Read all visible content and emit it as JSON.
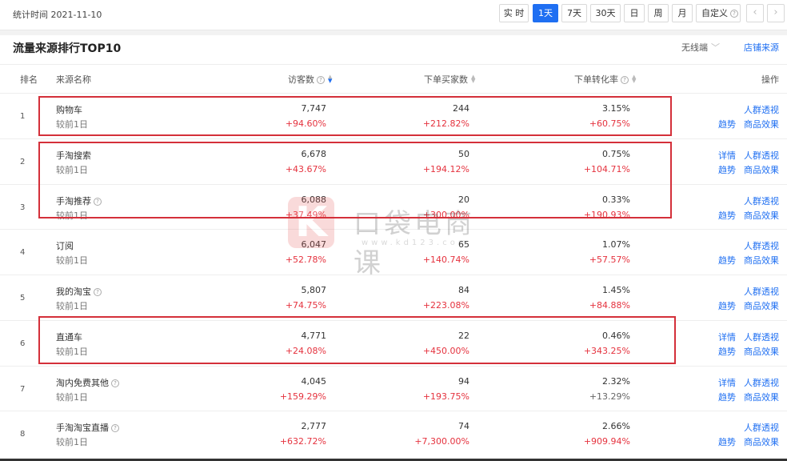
{
  "topbar": {
    "stat_time": "统计时间 2021-11-10",
    "buttons": [
      "实 时",
      "1天",
      "7天",
      "30天",
      "日",
      "周",
      "月",
      "自定义"
    ],
    "prev": "‹",
    "next": "›"
  },
  "section": {
    "title": "流量来源排行TOP10",
    "device": "无线端",
    "shop_source": "店铺来源"
  },
  "columns": {
    "rank": "排名",
    "source": "来源名称",
    "visitors": "访客数",
    "buyers": "下单买家数",
    "conversion": "下单转化率",
    "action": "操作"
  },
  "compare_label": "较前1日",
  "links": {
    "detail": "详情",
    "crowd": "人群透视",
    "trend": "趋势",
    "product": "商品效果"
  },
  "watermark": {
    "text": "口袋电商课",
    "url": "www.kd123.com"
  },
  "rows": [
    {
      "rank": "1",
      "name": "购物车",
      "visitors": "7,747",
      "visitors_chg": "+94.60%",
      "buyers": "244",
      "buyers_chg": "+212.82%",
      "conv": "3.15%",
      "conv_chg": "+60.75%"
    },
    {
      "rank": "2",
      "name": "手淘搜索",
      "visitors": "6,678",
      "visitors_chg": "+43.67%",
      "buyers": "50",
      "buyers_chg": "+194.12%",
      "conv": "0.75%",
      "conv_chg": "+104.71%"
    },
    {
      "rank": "3",
      "name": "手淘推荐",
      "visitors": "6,088",
      "visitors_chg": "+37.49%",
      "buyers": "20",
      "buyers_chg": "+300.00%",
      "conv": "0.33%",
      "conv_chg": "+190.93%"
    },
    {
      "rank": "4",
      "name": "订阅",
      "visitors": "6,047",
      "visitors_chg": "+52.78%",
      "buyers": "65",
      "buyers_chg": "+140.74%",
      "conv": "1.07%",
      "conv_chg": "+57.57%"
    },
    {
      "rank": "5",
      "name": "我的淘宝",
      "visitors": "5,807",
      "visitors_chg": "+74.75%",
      "buyers": "84",
      "buyers_chg": "+223.08%",
      "conv": "1.45%",
      "conv_chg": "+84.88%"
    },
    {
      "rank": "6",
      "name": "直通车",
      "visitors": "4,771",
      "visitors_chg": "+24.08%",
      "buyers": "22",
      "buyers_chg": "+450.00%",
      "conv": "0.46%",
      "conv_chg": "+343.25%"
    },
    {
      "rank": "7",
      "name": "淘内免费其他",
      "visitors": "4,045",
      "visitors_chg": "+159.29%",
      "buyers": "94",
      "buyers_chg": "+193.75%",
      "conv": "2.32%",
      "conv_chg": "+13.29%"
    },
    {
      "rank": "8",
      "name": "手淘淘宝直播",
      "visitors": "2,777",
      "visitors_chg": "+632.72%",
      "buyers": "74",
      "buyers_chg": "+7,300.00%",
      "conv": "2.66%",
      "conv_chg": "+909.94%"
    }
  ],
  "colors": {
    "accent": "#1f6ff2",
    "up": "#e5323e",
    "highlight_box": "#d4303a"
  }
}
